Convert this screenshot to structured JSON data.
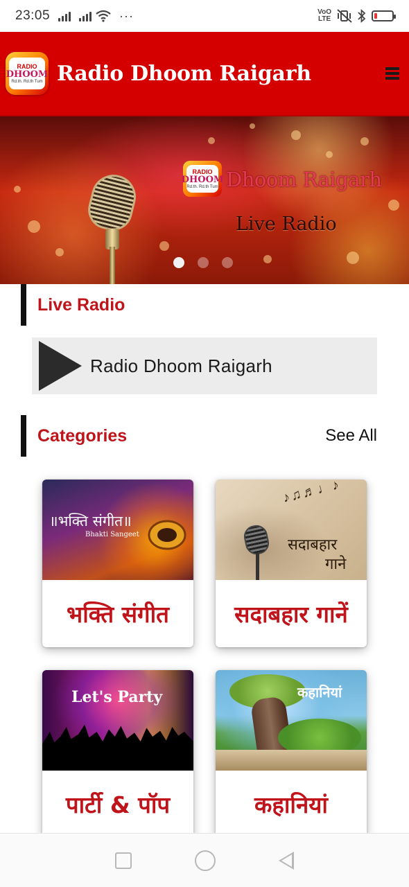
{
  "status_bar": {
    "time": "23:05",
    "more_indicator": "···",
    "network_label_top": "VoO",
    "network_label_bottom": "LTE",
    "battery_level_fraction": 0.15,
    "battery_color": "#e53935"
  },
  "app_bar": {
    "title": "Radio Dhoom Raigarh",
    "background_color": "#d40000",
    "logo": {
      "top_text": "RADIO",
      "word": "DHOOM",
      "sub_text": "Rd.th. Rd.th Tum"
    },
    "menu_icon": "hamburger-icon"
  },
  "banner": {
    "brand_text": "Dhoom Raigarh",
    "subtitle": "Live Radio",
    "slide_count": 3,
    "active_slide": 1
  },
  "live_radio": {
    "heading": "Live Radio",
    "player_label": "Radio Dhoom Raigarh",
    "play_icon": "play-icon"
  },
  "categories": {
    "heading": "Categories",
    "see_all": "See All",
    "items": [
      {
        "label": "भक्ति संगीत",
        "image_caption": "॥भक्ति संगीत॥",
        "image_subcaption": "Bhakti Sangeet"
      },
      {
        "label": "सदाबहार गानें",
        "image_caption": "सदाबहार",
        "image_subcaption": "गाने"
      },
      {
        "label": "पार्टी & पॉप",
        "image_caption": "Let's Party"
      },
      {
        "label": "कहानियां",
        "image_caption": "कहानियां"
      }
    ]
  },
  "nav_bar": {
    "recents_icon": "square-icon",
    "home_icon": "circle-icon",
    "back_icon": "back-triangle-icon"
  },
  "colors": {
    "accent_red": "#c0141b",
    "header_red": "#d40000",
    "section_bar": "#111111",
    "player_bg": "#ececec"
  }
}
